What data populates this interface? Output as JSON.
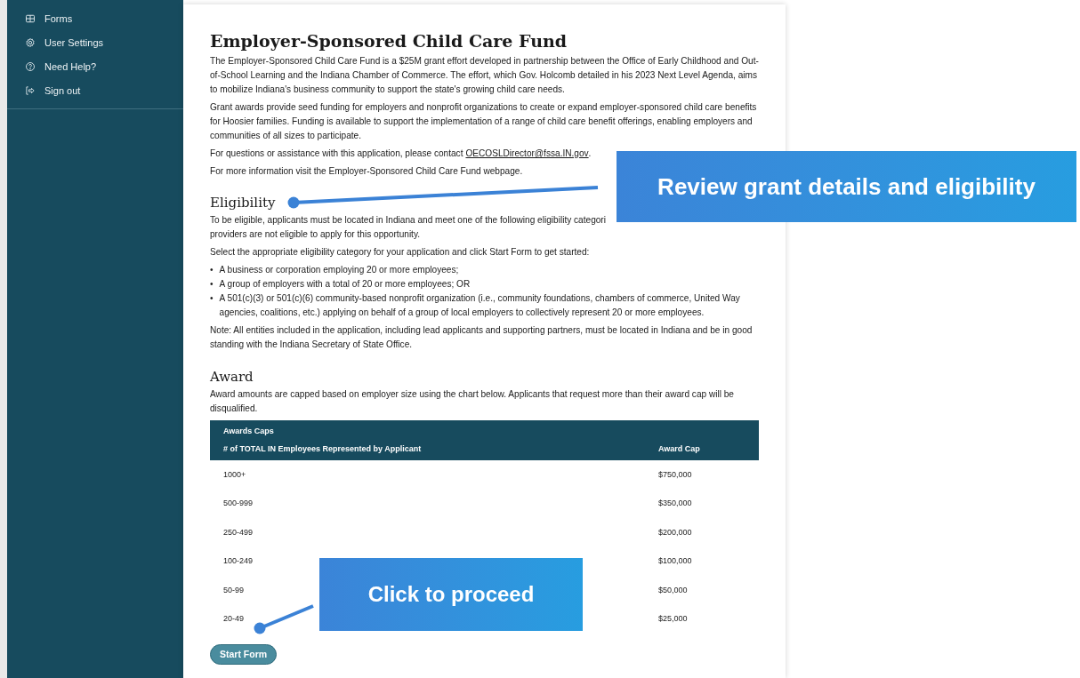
{
  "sidebar": {
    "items": [
      {
        "label": "Forms"
      },
      {
        "label": "User Settings"
      },
      {
        "label": "Need Help?"
      },
      {
        "label": "Sign out"
      }
    ]
  },
  "page": {
    "title": "Employer-Sponsored Child Care Fund",
    "intro": [
      "The Employer-Sponsored Child Care Fund is a $25M grant effort developed in partnership between the Office of Early Childhood and Out-of-School Learning and the Indiana Chamber of Commerce. The effort, which Gov. Holcomb detailed in his 2023 Next Level Agenda, aims to mobilize Indiana's business community to support the state's growing child care needs.",
      "Grant awards provide seed funding for employers and nonprofit organizations to create or expand employer-sponsored child care benefits for Hoosier families. Funding is available to support the implementation of a range of child care benefit offerings, enabling employers and communities of all sizes to participate."
    ],
    "contact_text": "For questions or assistance with this application, please contact",
    "contact_link": "OECOSLDirector@fssa.IN.gov",
    "contact_end": ".",
    "more_info": "For more information visit the Employer-Sponsored Child Care Fund webpage.",
    "eligibility": {
      "heading": "Eligibility",
      "intro_line_1": "To be eligible, applicants must be located in Indiana and meet one of the following eligibility categori",
      "intro_line_2": "providers are not eligible to apply for this opportunity.",
      "select_text": "Select the appropriate eligibility category for your application and click Start Form to get started:",
      "bullets": [
        "A business or corporation employing 20 or more employees;",
        "A group of employers with a total of 20 or more employees; OR",
        "A 501(c)(3) or 501(c)(6) community-based nonprofit organization (i.e., community foundations, chambers of commerce, United Way agencies, coalitions, etc.) applying on behalf of a group of local employers to collectively represent 20 or more employees."
      ],
      "bullet_mark": "•",
      "note": "Note: All entities included in the application, including lead applicants and supporting partners, must be located in Indiana and be in good standing with the Indiana Secretary of State Office."
    },
    "award": {
      "heading": "Award",
      "text": "Award amounts are capped based on employer size using the chart below. Applicants that request more than their award cap will be disqualified.",
      "table": {
        "caption": "Awards Caps",
        "columns": [
          "# of TOTAL IN Employees Represented by Applicant",
          "Award Cap"
        ],
        "rows": [
          [
            "1000+",
            "$750,000"
          ],
          [
            "500-999",
            "$350,000"
          ],
          [
            "250-499",
            "$200,000"
          ],
          [
            "100-249",
            "$100,000"
          ],
          [
            "50-99",
            "$50,000"
          ],
          [
            "20-49",
            "$25,000"
          ]
        ]
      }
    },
    "start_button": "Start Form"
  },
  "callouts": [
    {
      "text": "Review grant details and eligibility"
    },
    {
      "text": "Click to proceed"
    }
  ]
}
